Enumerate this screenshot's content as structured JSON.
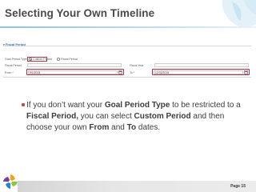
{
  "slide": {
    "title": "Selecting Your Own Timeline",
    "page_label": "Page 15"
  },
  "panel": {
    "header": "Fiscal Period",
    "goal_period_type_label": "Goal Period Type",
    "custom_period_label": "Custom Period",
    "fiscal_period_option_label": "Fiscal Period",
    "fiscal_period_label": "Fiscal Period",
    "fiscal_year_label": "Fiscal Year",
    "from_label": "From *",
    "to_label": "To *",
    "from_value": "9/1/2015",
    "to_value": "12/31/2015",
    "selected_option": "Custom Period"
  },
  "bullet": {
    "p1": "If you don’t want your ",
    "b1": "Goal Period Type",
    "p2": " to be restricted to a ",
    "b2": "Fiscal Period,",
    "p3": " you can select ",
    "b3": "Custom Period",
    "p4": " and then choose your own ",
    "b4": "From",
    "p5": " and ",
    "b5": "To",
    "p6": " dates."
  },
  "colors": {
    "accent_red": "#c0504d",
    "title_rule": "#8ec3e0",
    "footer_bar": "#dcdcdc"
  },
  "icons": {
    "section_arrow": "triangle-down-icon",
    "calendar": "calendar-icon",
    "logo": "pinwheel-logo-icon"
  }
}
